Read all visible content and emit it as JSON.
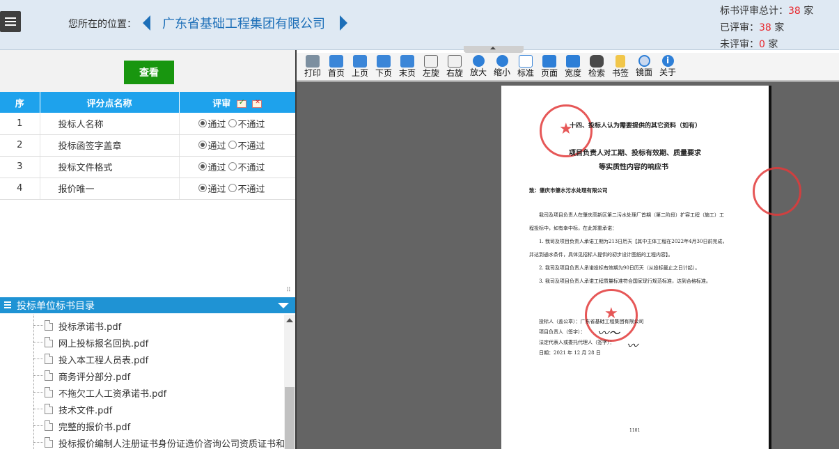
{
  "header": {
    "location_label": "您所在的位置：",
    "company": "广东省基础工程集团有限公司",
    "stats": {
      "total_label": "标书评审总计：",
      "total": "38",
      "total_unit": "家",
      "reviewed_label": "已评审：",
      "reviewed": "38",
      "reviewed_unit": "家",
      "unreviewed_label": "未评审：",
      "unreviewed": "0",
      "unreviewed_unit": "家"
    }
  },
  "left": {
    "view_button": "查看",
    "table": {
      "headers": {
        "index": "序",
        "name": "评分点名称",
        "review": "评审"
      },
      "rows": [
        {
          "index": "1",
          "name": "投标人名称",
          "pass": "通过",
          "fail": "不通过",
          "selected": "pass"
        },
        {
          "index": "2",
          "name": "投标函签字盖章",
          "pass": "通过",
          "fail": "不通过",
          "selected": "pass"
        },
        {
          "index": "3",
          "name": "投标文件格式",
          "pass": "通过",
          "fail": "不通过",
          "selected": "pass"
        },
        {
          "index": "4",
          "name": "报价唯一",
          "pass": "通过",
          "fail": "不通过",
          "selected": "pass"
        }
      ]
    },
    "directory": {
      "title": "投标单位标书目录",
      "files": [
        "投标承诺书.pdf",
        "网上投标报名回执.pdf",
        "投入本工程人员表.pdf",
        "商务评分部分.pdf",
        "不拖欠工人工资承诺书.pdf",
        "技术文件.pdf",
        "完整的报价书.pdf",
        "投标报价编制人注册证书身份证造价咨询公司资质证书和委托"
      ]
    }
  },
  "toolbar": {
    "print": "打印",
    "first": "首页",
    "prev": "上页",
    "next": "下页",
    "last": "末页",
    "rotate_left": "左旋",
    "rotate_right": "右旋",
    "zoom_in": "放大",
    "zoom_out": "缩小",
    "standard": "标准",
    "fit_page": "页面",
    "fit_width": "宽度",
    "search": "检索",
    "bookmark": "书签",
    "mirror": "镜面",
    "about": "关于"
  },
  "document": {
    "heading": "十四、投标人认为需要提供的其它资料（如有）",
    "title_line1": "项目负责人对工期、投标有效期、质量要求",
    "title_line2": "等实质性内容的响应书",
    "recipient": "致：肇庆市肇水污水处理有限公司",
    "body": [
      "我司及项目负责人在肇庆高新区第二污水处理厂首期（第二阶段）扩容工程（施工）工",
      "程投标中，如有幸中标，在此郑重承诺：",
      "1. 我司及项目负责人承诺工期为213日历天【其中主体工程在2022年4月30日前完成，",
      "并达到通水条件，具体见招标人提供的初步设计图纸的工程内容】。",
      "2. 我司及项目负责人承诺投标有效期为90日历天（从投标截止之日计起）。",
      "3. 我司及项目负责人承诺工程质量标准符合国家现行规范标准，达到合格标准。"
    ],
    "sign_bidder": "投标人（盖公章）：广东省基础工程集团有限公司",
    "sign_manager": "项目负责人（签字）：",
    "sign_legal": "法定代表人或委托代理人（签字）：",
    "sign_date": "日期：2021 年 12 月 28 日",
    "page_number": "1101"
  },
  "colors": {
    "accent": "#1ea2ec",
    "header_bg": "#dfe9f3",
    "view_button": "#18960f",
    "stat_number": "#e8262c",
    "link": "#1d6fb8"
  }
}
